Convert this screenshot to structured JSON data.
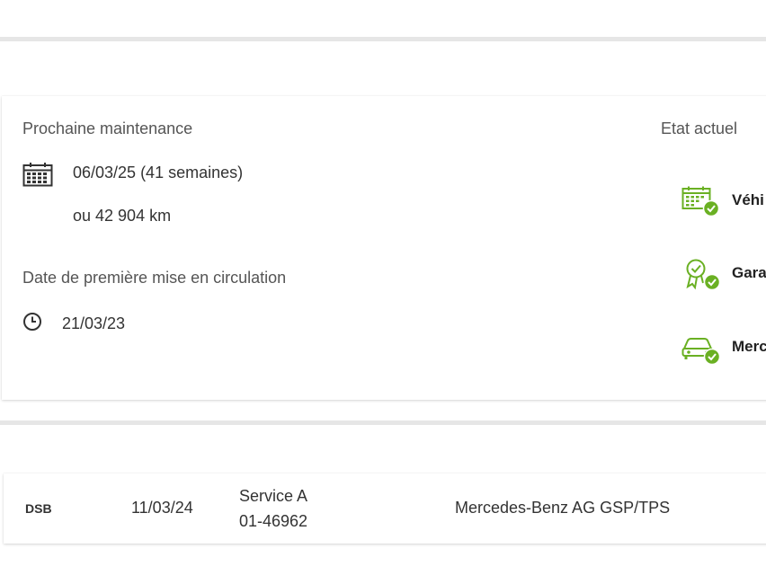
{
  "maintenance": {
    "next_label": "Prochaine maintenance",
    "next_date": "06/03/25 (41 semaines)",
    "next_km": "ou 42 904 km",
    "first_registration_label": "Date de première mise en circulation",
    "first_registration_date": "21/03/23"
  },
  "status": {
    "title": "Etat actuel",
    "items": [
      {
        "label": "Véhi",
        "icon": "calendar-check-icon"
      },
      {
        "label": "Gara",
        "icon": "warranty-badge-check-icon"
      },
      {
        "label": "Merc",
        "icon": "car-check-icon"
      }
    ],
    "accent_color": "#6ab023"
  },
  "history": {
    "rows": [
      {
        "source": "DSB",
        "date": "11/03/24",
        "service": "Service A",
        "code": "01-46962",
        "workshop": "Mercedes-Benz AG GSP/TPS"
      }
    ]
  }
}
